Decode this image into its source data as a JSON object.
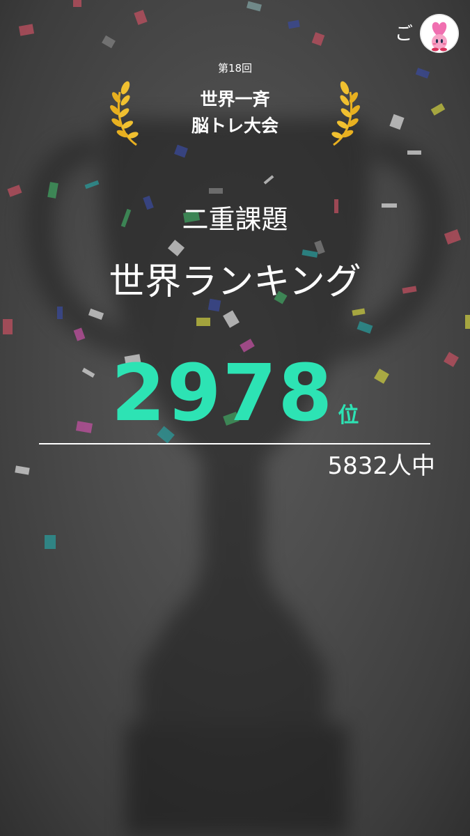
{
  "header": {
    "user_name": "ご",
    "avatar_icon": "kirby-heart-icon"
  },
  "badge": {
    "round": "第18回",
    "event_line1": "世界一斉",
    "event_line2": "脳トレ大会",
    "laurel_icon": "laurel-icon"
  },
  "result": {
    "mode": "二重課題",
    "title": "世界ランキング",
    "rank": "2978",
    "rank_unit": "位",
    "participants": "5832人中"
  },
  "colors": {
    "accent": "#2de3b4",
    "gold": "#e8b020",
    "background": "#4a4a4a"
  }
}
